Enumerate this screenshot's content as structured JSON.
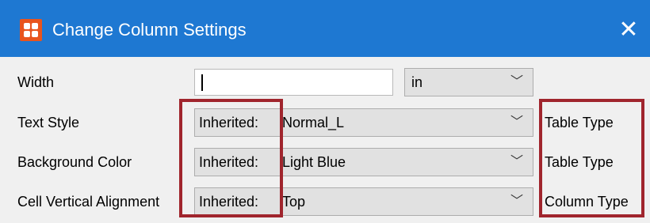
{
  "window": {
    "title": "Change Column Settings",
    "close_symbol": "✕",
    "app_icon": "app-grid-icon",
    "colors": {
      "titlebar": "#1e78d2",
      "icon": "#e8541e",
      "highlight": "#a0252d"
    }
  },
  "rows": [
    {
      "label": "Width",
      "input_value": "",
      "unit": "in"
    },
    {
      "label": "Text Style",
      "inherited": "Inherited:",
      "value": "Normal_L",
      "source": "Table Type"
    },
    {
      "label": "Background Color",
      "inherited": "Inherited:",
      "value": "Light Blue",
      "source": "Table Type"
    },
    {
      "label": "Cell Vertical Alignment",
      "inherited": "Inherited:",
      "value": "Top",
      "source": "Column Type"
    }
  ],
  "chevron": "﹀"
}
